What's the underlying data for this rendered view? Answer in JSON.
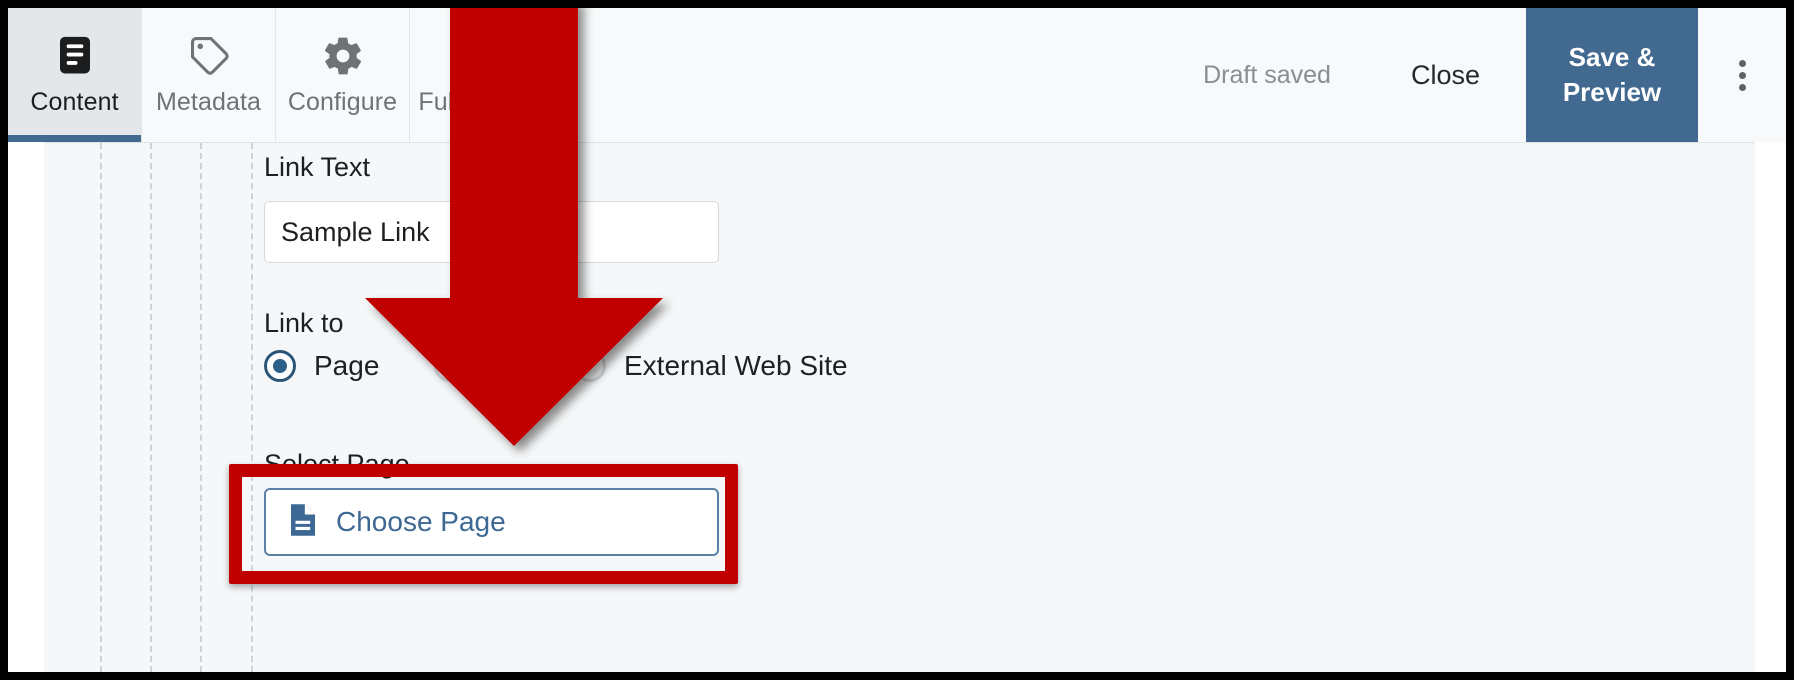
{
  "toolbar": {
    "tabs": [
      {
        "label": "Content",
        "icon": "content-document-icon",
        "active": true
      },
      {
        "label": "Metadata",
        "icon": "tag-icon",
        "active": false
      },
      {
        "label": "Configure",
        "icon": "gear-icon",
        "active": false
      },
      {
        "label": "Fullscreen",
        "icon": "fullscreen-expand-icon",
        "active": false
      }
    ],
    "status_text": "Draft saved",
    "close_label": "Close",
    "save_preview_label": "Save & Preview",
    "overflow_icon": "kebab-menu-icon"
  },
  "form": {
    "link_text": {
      "label": "Link Text",
      "value": "Sample Link",
      "placeholder": ""
    },
    "link_to": {
      "label": "Link to",
      "options": [
        {
          "label": "Page",
          "selected": true
        },
        {
          "label": "",
          "selected": false
        },
        {
          "label": "External Web Site",
          "selected": false
        }
      ]
    },
    "select_page": {
      "label": "Select Page",
      "button_label": "Choose Page",
      "button_icon": "file-document-icon"
    }
  },
  "annotations": {
    "arrow": {
      "color": "#c00000",
      "direction": "down",
      "name": "red-down-arrow"
    },
    "highlight": {
      "color": "#c00000",
      "name": "red-highlight-box"
    }
  },
  "colors": {
    "accent": "#42698f",
    "annotation": "#c00000",
    "canvas_bg": "#f5f7f9",
    "toolbar_bg": "#f7f9fa",
    "active_tab_bg": "#e4e7e9"
  }
}
